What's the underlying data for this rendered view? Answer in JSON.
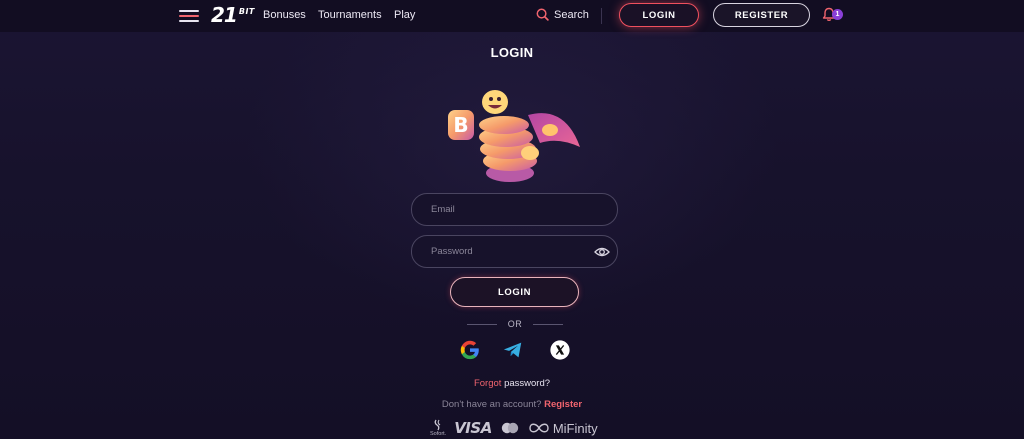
{
  "header": {
    "logo_num": "21",
    "logo_suffix": "BIT",
    "nav": [
      "Bonuses",
      "Tournaments",
      "Play"
    ],
    "search_label": "Search",
    "login_label": "LOGIN",
    "register_label": "REGISTER",
    "notification_count": "1"
  },
  "form": {
    "title": "LOGIN",
    "email_placeholder": "Email",
    "password_placeholder": "Password",
    "submit_label": "LOGIN",
    "or_label": "OR",
    "forgot_prefix": "Forgot",
    "forgot_suffix": "password?",
    "no_account_text": "Don't have an account?",
    "register_link": "Register"
  },
  "social_icons": [
    "google-icon",
    "telegram-icon",
    "x-icon"
  ],
  "payments": {
    "sofort_label": "Sofort.",
    "visa_label": "VISA",
    "mifinity_label": "MiFinity"
  },
  "colors": {
    "accent": "#f0505e",
    "background": "#16112a",
    "header": "#120d22"
  }
}
